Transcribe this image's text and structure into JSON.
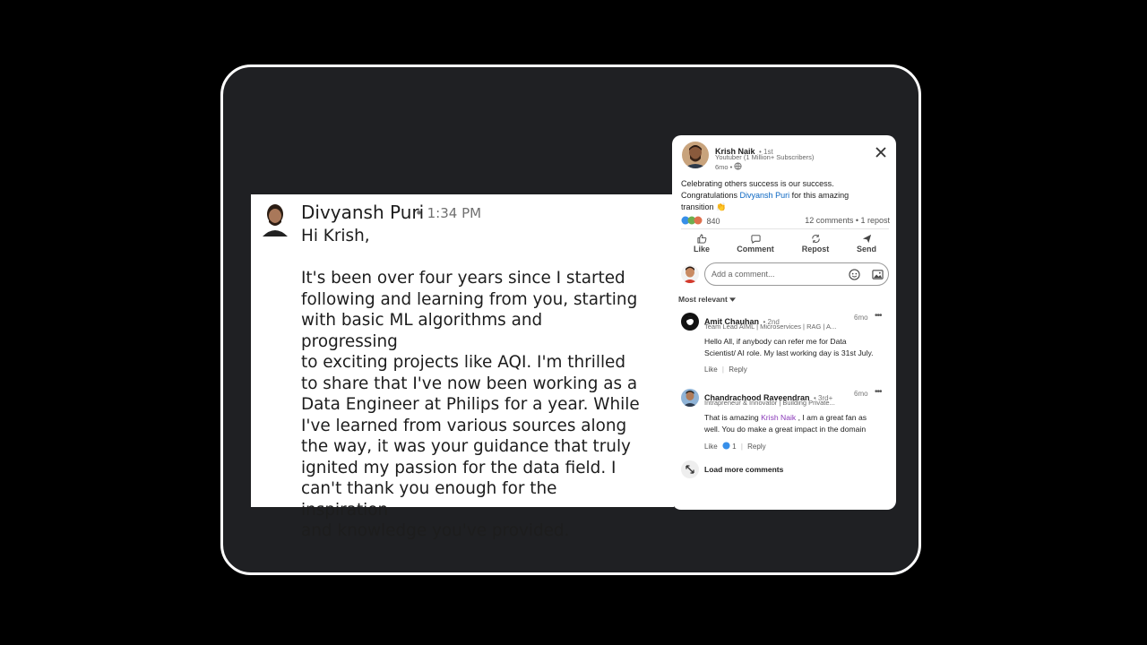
{
  "message": {
    "sender": "Divyansh Puri",
    "separator": "•",
    "time": "1:34 PM",
    "greeting": "Hi Krish,",
    "body_lines": [
      "It's been over four years since I started",
      "following and learning from you, starting",
      "with basic ML algorithms and progressing",
      "to exciting projects like AQI. I'm thrilled",
      "to share that I've now been working as a",
      "Data Engineer at Philips for a year. While",
      "I've learned from various sources along",
      "the way, it was your guidance that truly",
      "ignited my passion for the data field. I",
      "can't thank you enough for the inspiration",
      "and knowledge you've provided."
    ]
  },
  "post": {
    "author": "Krish Naik",
    "degree": "• 1st",
    "headline": "Youtuber (1 Million+ Subscribers)",
    "age": "6mo •",
    "text_line1": "Celebrating others success is our success.",
    "text_line2_prefix": "Congratulations ",
    "mention": "Divyansh Puri",
    "text_line2_suffix": " for this amazing",
    "text_line3": "transition 👏",
    "reactions_count": "840",
    "comments_reposts": "12 comments • 1 repost",
    "actions": [
      "Like",
      "Comment",
      "Repost",
      "Send"
    ],
    "comment_placeholder": "Add a comment...",
    "sort_label": "Most relevant",
    "comments": [
      {
        "name": "Amit Chauhan",
        "degree": "• 2nd",
        "headline": "Team Lead AIML | Microservices | RAG | A...",
        "age": "6mo",
        "text_line1": "Hello All, if anybody can refer me for Data",
        "text_line2": "Scientist/ AI role. My last working day is 31st July.",
        "like": "Like",
        "reply": "Reply"
      },
      {
        "name": "Chandrachood Raveendran",
        "degree": "• 3rd+",
        "headline": "Intrapreneur & Innovator | Building Private...",
        "age": "6mo",
        "text_prefix": "That is amazing ",
        "mention": "Krish Naik",
        "text_suffix": " , I am a great fan as",
        "text_line2": "well. You do make a great impact in the domain",
        "like": "Like",
        "reaction_count": "1",
        "reply": "Reply"
      }
    ],
    "load_more": "Load more comments"
  }
}
